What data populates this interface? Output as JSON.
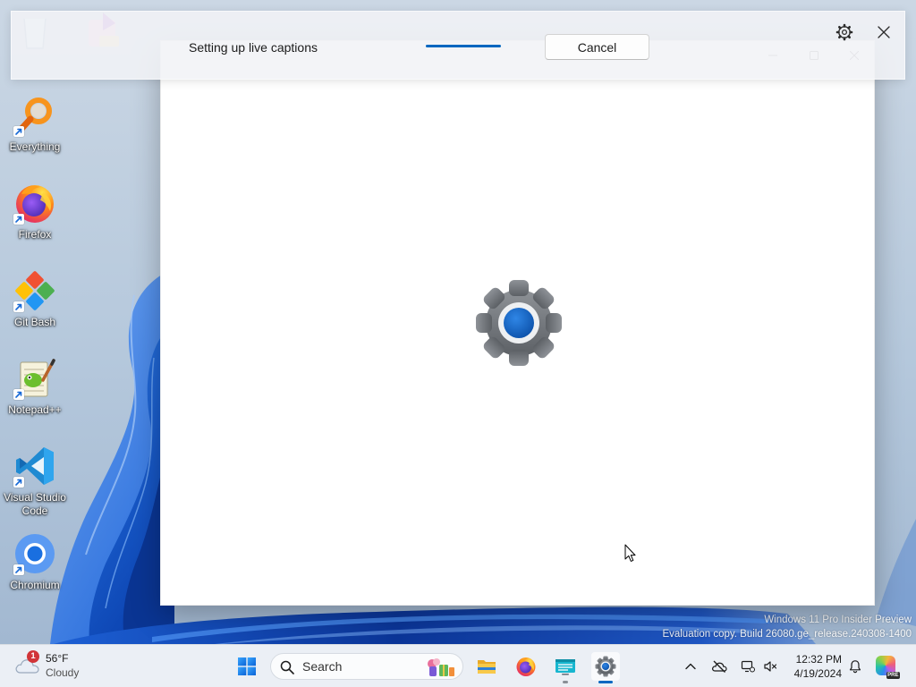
{
  "desktop": {
    "icons": [
      {
        "label": "Everything",
        "icon": "everything-search-icon",
        "shortcut": true
      },
      {
        "label": "Firefox",
        "icon": "firefox-icon",
        "shortcut": true
      },
      {
        "label": "Git Bash",
        "icon": "git-bash-icon",
        "shortcut": true
      },
      {
        "label": "Notepad++",
        "icon": "notepad-plus-plus-icon",
        "shortcut": true
      },
      {
        "label": "Visual Studio Code",
        "icon": "vscode-icon",
        "shortcut": true
      },
      {
        "label": "Chromium",
        "icon": "chromium-icon",
        "shortcut": true
      }
    ],
    "watermark": {
      "line1": "Windows 11 Pro Insider Preview",
      "line2": "Evaluation copy. Build 26080.ge_release.240308-1400"
    }
  },
  "live_captions": {
    "status": "Setting up live captions",
    "progress": "indeterminate",
    "cancel_label": "Cancel",
    "settings_icon": "gear-icon",
    "close_icon": "close-icon"
  },
  "settings_window": {
    "splash_icon": "settings-gear-icon",
    "caption_icons": [
      "minimize-icon",
      "maximize-icon",
      "close-icon"
    ]
  },
  "taskbar": {
    "weather": {
      "icon": "cloudy-weather-icon",
      "badge": "1",
      "temperature": "56°F",
      "condition": "Cloudy"
    },
    "start_icon": "windows-start-icon",
    "search": {
      "icon": "search-icon",
      "placeholder": "Search",
      "highlight_icon": "search-highlight-icon"
    },
    "pinned_apps": [
      {
        "icon": "file-explorer-icon",
        "running": false,
        "active": false
      },
      {
        "icon": "firefox-icon",
        "running": false,
        "active": false
      },
      {
        "icon": "app-window-icon",
        "running": true,
        "active": false
      },
      {
        "icon": "settings-icon",
        "running": true,
        "active": true
      }
    ],
    "tray": {
      "icons": [
        "chevron-up-icon",
        "onedrive-offline-icon",
        "display-icon",
        "volume-icon"
      ],
      "time": "12:32 PM",
      "date": "4/19/2024",
      "notification_icon": "bell-icon",
      "copilot_icon": "copilot-icon",
      "copilot_badge": "PRE"
    }
  },
  "colors": {
    "accent": "#0067c0",
    "badge_red": "#d13438",
    "wallpaper_top": "#cbd7e4",
    "bloom_blue": "#1f63d6"
  }
}
